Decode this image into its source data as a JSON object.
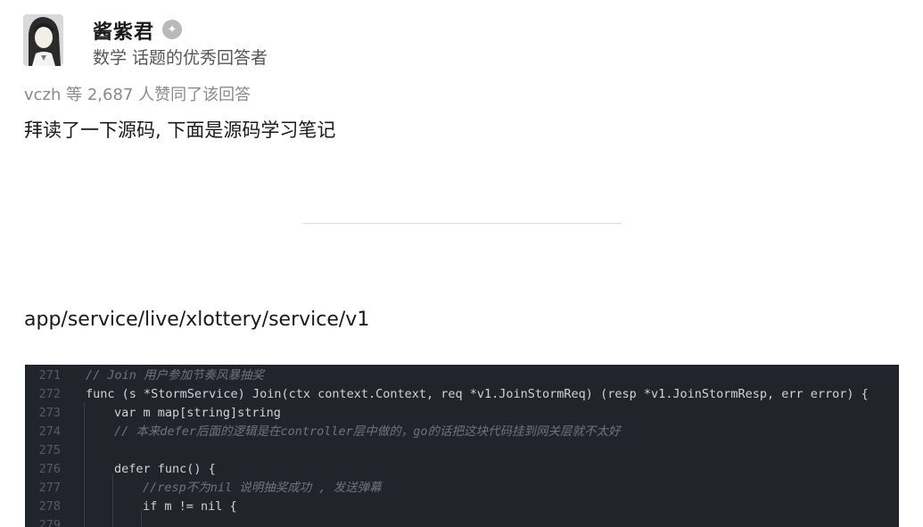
{
  "author": {
    "name": "酱紫君",
    "badge_icon": "badge-icon",
    "headline": "数学 话题的优秀回答者"
  },
  "vote_line": "vczh 等 2,687 人赞同了该回答",
  "answer": {
    "intro": "拜读了一下源码, 下面是源码学习笔记",
    "path": "app/service/live/xlottery/service/v1"
  },
  "code": {
    "lines": [
      {
        "num": "271",
        "text": "// Join 用户参加节奏风暴抽奖",
        "type": "comment"
      },
      {
        "num": "272",
        "text": "func (s *StormService) Join(ctx context.Context, req *v1.JoinStormReq) (resp *v1.JoinStormResp, err error) {",
        "type": "code"
      },
      {
        "num": "273",
        "text": "var m map[string]string",
        "type": "code"
      },
      {
        "num": "274",
        "text": "// 本来defer后面的逻辑是在controller层中做的，go的话把这块代码挂到网关层就不太好",
        "type": "comment"
      },
      {
        "num": "275",
        "text": "",
        "type": "code"
      },
      {
        "num": "276",
        "text": "defer func() {",
        "type": "code"
      },
      {
        "num": "277",
        "text": "//resp不为nil 说明抽奖成功 , 发送弹幕",
        "type": "comment"
      },
      {
        "num": "278",
        "text": "if m != nil {",
        "type": "code"
      },
      {
        "num": "279",
        "text": "",
        "type": "code"
      }
    ]
  }
}
